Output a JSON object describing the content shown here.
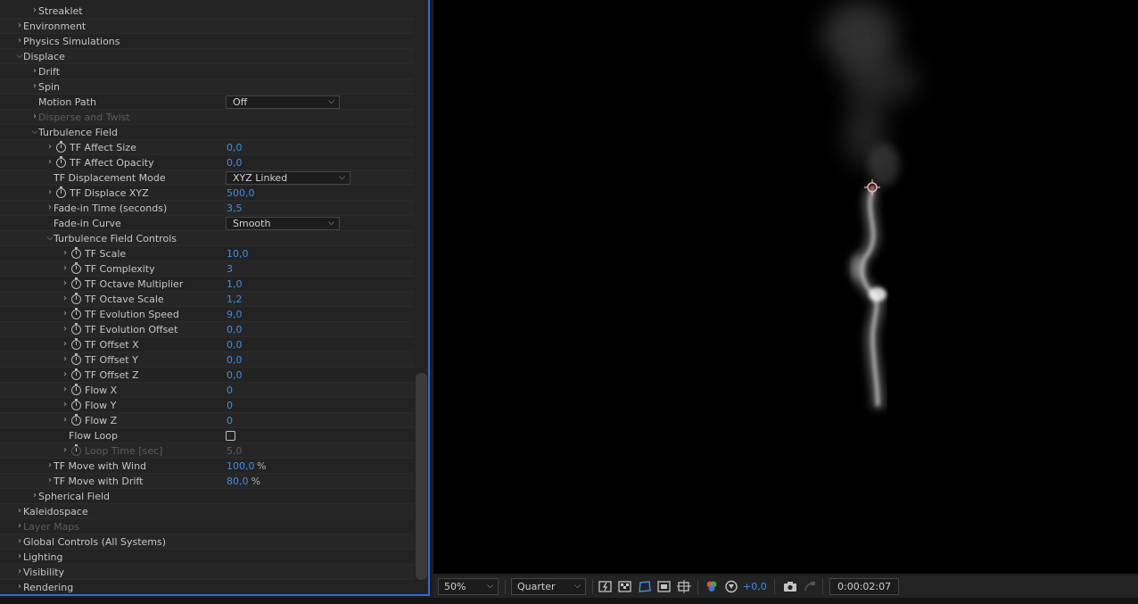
{
  "rows": [
    {
      "label": "Streaklet",
      "arrow": "right",
      "indent": 34,
      "dim": false
    },
    {
      "label": "Environment",
      "arrow": "right",
      "indent": 17,
      "dim": false
    },
    {
      "label": "Physics Simulations",
      "arrow": "right",
      "indent": 17,
      "dim": false
    },
    {
      "label": "Displace",
      "arrow": "down",
      "indent": 17,
      "dim": false
    },
    {
      "label": "Drift",
      "arrow": "right",
      "indent": 34,
      "dim": false
    },
    {
      "label": "Spin",
      "arrow": "right",
      "indent": 34,
      "dim": false
    },
    {
      "label": "Motion Path",
      "arrow": "",
      "indent": 34,
      "dim": false,
      "dropdown": "Off",
      "ddWidth": 128
    },
    {
      "label": "Disperse and Twist",
      "arrow": "right",
      "indent": 34,
      "dim": true
    },
    {
      "label": "Turbulence Field",
      "arrow": "down",
      "indent": 34,
      "dim": false
    },
    {
      "label": "TF Affect Size",
      "arrow": "right",
      "indent": 51,
      "stopwatch": true,
      "value": "0,0"
    },
    {
      "label": "TF Affect Opacity",
      "arrow": "right",
      "indent": 51,
      "stopwatch": true,
      "value": "0,0"
    },
    {
      "label": "TF Displacement Mode",
      "arrow": "",
      "indent": 51,
      "dropdown": "XYZ Linked",
      "ddWidth": 140
    },
    {
      "label": "TF Displace XYZ",
      "arrow": "right",
      "indent": 51,
      "stopwatch": true,
      "value": "500,0"
    },
    {
      "label": "Fade-in Time (seconds)",
      "arrow": "right",
      "indent": 51,
      "value": "3,5"
    },
    {
      "label": "Fade-in Curve",
      "arrow": "",
      "indent": 51,
      "dropdown": "Smooth",
      "ddWidth": 128
    },
    {
      "label": "Turbulence Field Controls",
      "arrow": "down",
      "indent": 51
    },
    {
      "label": "TF Scale",
      "arrow": "right",
      "indent": 68,
      "stopwatch": true,
      "value": "10,0"
    },
    {
      "label": "TF Complexity",
      "arrow": "right",
      "indent": 68,
      "stopwatch": true,
      "value": "3"
    },
    {
      "label": "TF Octave Multiplier",
      "arrow": "right",
      "indent": 68,
      "stopwatch": true,
      "value": "1,0"
    },
    {
      "label": "TF Octave Scale",
      "arrow": "right",
      "indent": 68,
      "stopwatch": true,
      "value": "1,2"
    },
    {
      "label": "TF Evolution Speed",
      "arrow": "right",
      "indent": 68,
      "stopwatch": true,
      "value": "9,0"
    },
    {
      "label": "TF Evolution Offset",
      "arrow": "right",
      "indent": 68,
      "stopwatch": true,
      "value": "0,0"
    },
    {
      "label": "TF Offset X",
      "arrow": "right",
      "indent": 68,
      "stopwatch": true,
      "value": "0,0"
    },
    {
      "label": "TF Offset Y",
      "arrow": "right",
      "indent": 68,
      "stopwatch": true,
      "value": "0,0"
    },
    {
      "label": "TF Offset Z",
      "arrow": "right",
      "indent": 68,
      "stopwatch": true,
      "value": "0,0"
    },
    {
      "label": "Flow X",
      "arrow": "right",
      "indent": 68,
      "stopwatch": true,
      "value": "0"
    },
    {
      "label": "Flow Y",
      "arrow": "right",
      "indent": 68,
      "stopwatch": true,
      "value": "0"
    },
    {
      "label": "Flow Z",
      "arrow": "right",
      "indent": 68,
      "stopwatch": true,
      "value": "0"
    },
    {
      "label": "Flow Loop",
      "arrow": "",
      "indent": 68,
      "checkbox": true
    },
    {
      "label": "Loop Time [sec]",
      "arrow": "right",
      "indent": 68,
      "stopwatch": true,
      "value": "5,0",
      "dim": true
    },
    {
      "label": "TF Move with Wind",
      "arrow": "right",
      "indent": 51,
      "value": "100,0",
      "unit": "%"
    },
    {
      "label": "TF Move with Drift",
      "arrow": "right",
      "indent": 51,
      "value": "80,0",
      "unit": "%"
    },
    {
      "label": "Spherical Field",
      "arrow": "right",
      "indent": 34
    },
    {
      "label": "Kaleidospace",
      "arrow": "right",
      "indent": 17
    },
    {
      "label": "Layer Maps",
      "arrow": "right",
      "indent": 17,
      "dim": true
    },
    {
      "label": "Global Controls (All Systems)",
      "arrow": "right",
      "indent": 17
    },
    {
      "label": "Lighting",
      "arrow": "right",
      "indent": 17
    },
    {
      "label": "Visibility",
      "arrow": "right",
      "indent": 17
    },
    {
      "label": "Rendering",
      "arrow": "right",
      "indent": 17
    }
  ],
  "toolbar": {
    "zoom": "50%",
    "resolution": "Quarter",
    "exposure": "+0,0",
    "timecode": "0:00:02:07"
  },
  "colors": {
    "accent": "#3d8fe8",
    "panel": "#232323",
    "viewer": "#000000"
  }
}
